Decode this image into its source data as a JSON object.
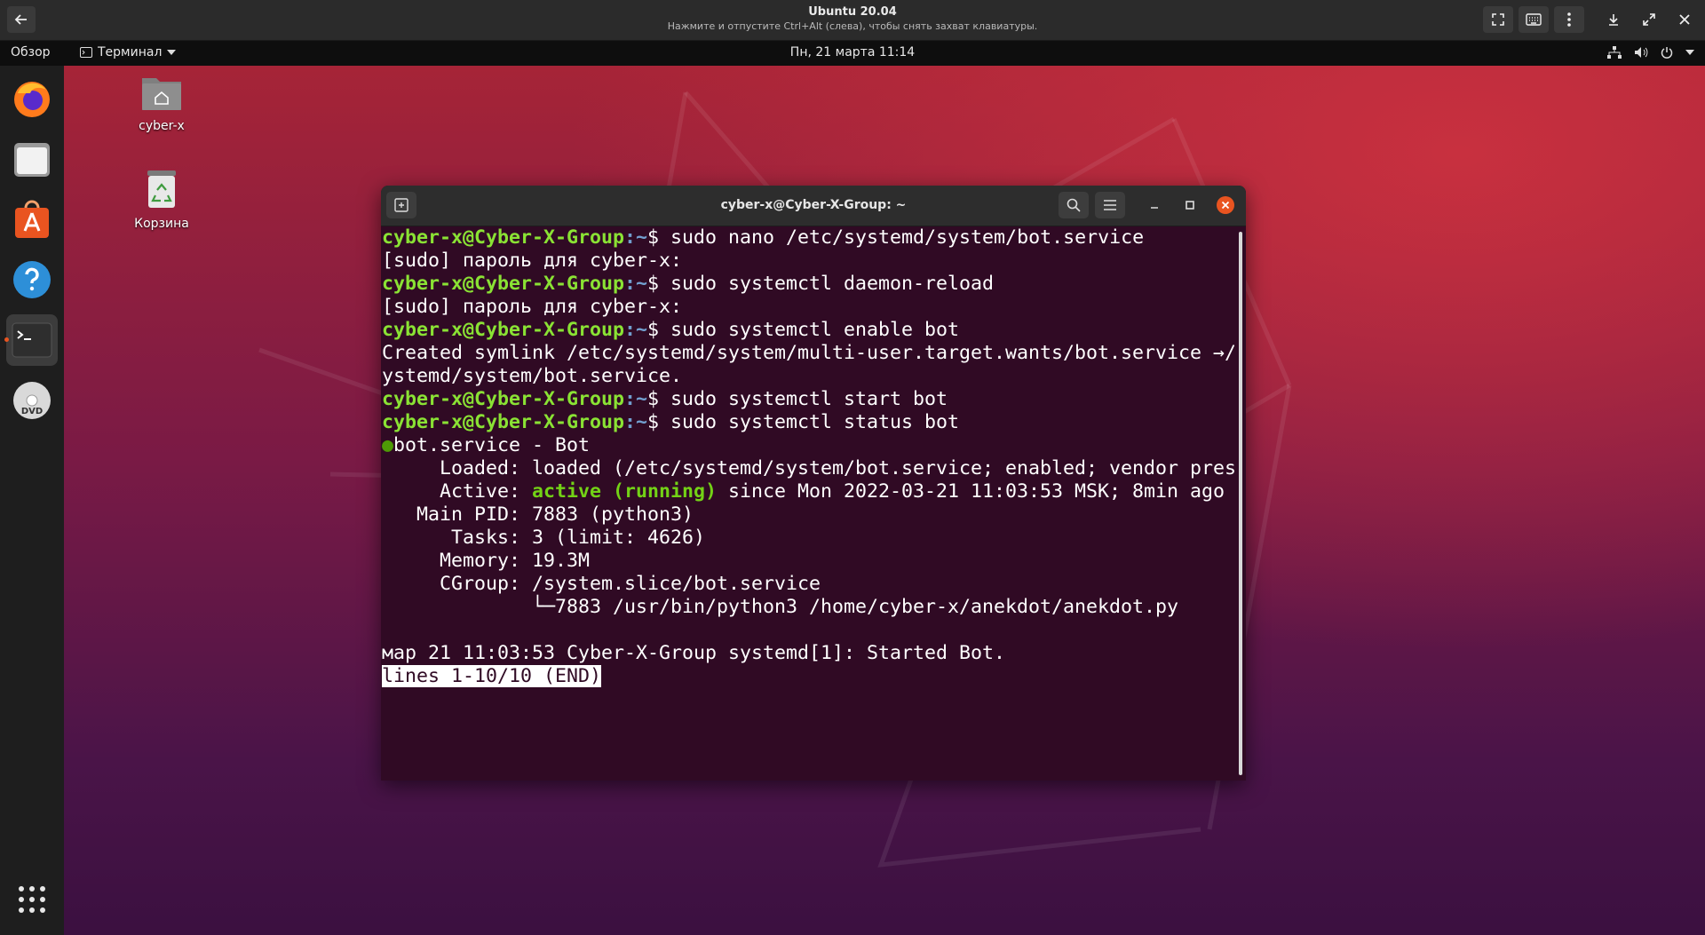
{
  "vm": {
    "title": "Ubuntu 20.04",
    "subtitle": "Нажмите и отпустите Ctrl+Alt (слева), чтобы снять захват клавиатуры."
  },
  "panel": {
    "activities": "Обзор",
    "app_menu": "Терминал",
    "clock": "Пн, 21 марта  11:14"
  },
  "desktop": {
    "icons": [
      {
        "label": "cyber-x",
        "icon": "home-folder-icon"
      },
      {
        "label": "Корзина",
        "icon": "trash-icon"
      }
    ]
  },
  "dock": {
    "items": [
      "firefox-icon",
      "files-icon",
      "software-icon",
      "help-icon",
      "terminal-icon",
      "dvd-icon"
    ],
    "show_apps": "apps-grid-icon"
  },
  "terminal": {
    "title": "cyber-x@Cyber-X-Group: ~",
    "prompt_user": "cyber-x@Cyber-X-Group",
    "prompt_path": ":~",
    "prompt_sigil": "$ ",
    "cmd1": "sudo nano /etc/systemd/system/bot.service",
    "sudo1": "[sudo] пароль для cyber-x:",
    "cmd2": "sudo systemctl daemon-reload",
    "sudo2": "[sudo] пароль для cyber-x:",
    "cmd3": "sudo systemctl enable bot",
    "symlink1": "Created symlink /etc/systemd/system/multi-user.target.wants/bot.service →/etc/s",
    "symlink2": "ystemd/system/bot.service.",
    "cmd4": "sudo systemctl start bot",
    "cmd5": "sudo systemctl status bot",
    "status_dot": "●",
    "status_name": "bot.service - Bot",
    "loaded": "     Loaded: loaded (/etc/systemd/system/bot.service; enabled; vendor preset: e",
    "loaded_more": ">",
    "active_label": "     Active: ",
    "active_state": "active (running)",
    "active_rest": " since Mon 2022-03-21 11:03:53 MSK; 8min ago",
    "main_pid": "   Main PID: 7883 (python3)",
    "tasks": "      Tasks: 3 (limit: 4626)",
    "memory": "     Memory: 19.3M",
    "cgroup": "     CGroup: /system.slice/bot.service",
    "cgroup_tree": "             └─7883 /usr/bin/python3 /home/cyber-x/anekdot/anekdot.py",
    "log": "мар 21 11:03:53 Cyber-X-Group systemd[1]: Started Bot.",
    "pager": "lines 1-10/10 (END)"
  },
  "colors": {
    "terminal_bg": "#300a24",
    "prompt_green": "#8ae234",
    "path_blue": "#729fcf",
    "dock_running": "#e95420"
  }
}
